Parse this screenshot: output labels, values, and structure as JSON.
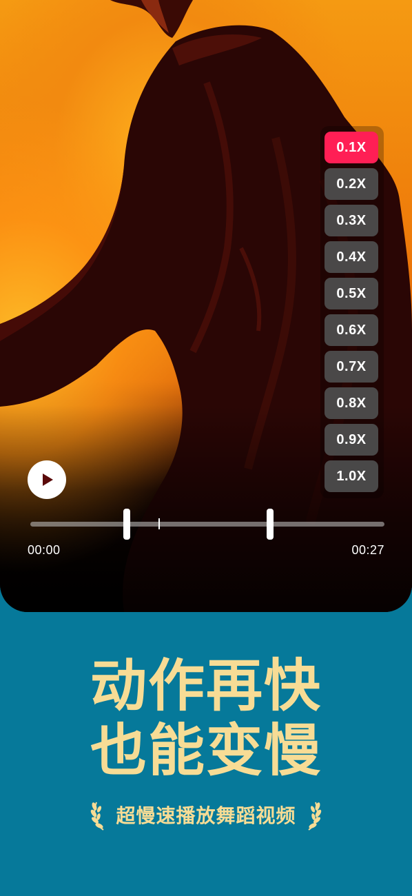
{
  "video": {
    "speed_options": [
      "0.1X",
      "0.2X",
      "0.3X",
      "0.4X",
      "0.5X",
      "0.6X",
      "0.7X",
      "0.8X",
      "0.9X",
      "1.0X"
    ],
    "selected_speed": "0.1X",
    "time_start": "00:00",
    "time_end": "00:27",
    "accent_color": "#ff1f55"
  },
  "promo": {
    "headline_line1": "动作再快",
    "headline_line2": "也能变慢",
    "subtitle": "超慢速播放舞蹈视频",
    "text_color": "#f7dc95",
    "background_color": "#06799a"
  }
}
